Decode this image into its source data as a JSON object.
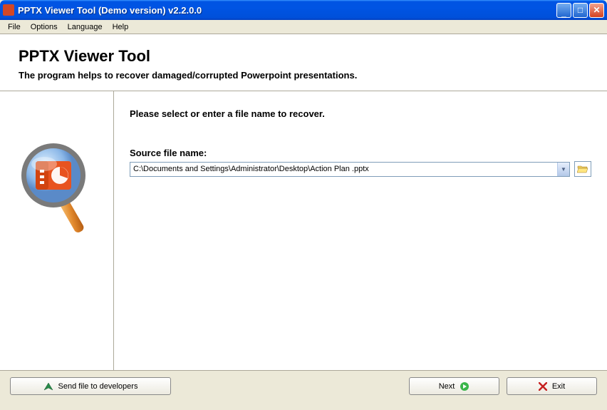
{
  "window": {
    "title": "PPTX Viewer Tool (Demo version) v2.2.0.0"
  },
  "menu": {
    "items": [
      "File",
      "Options",
      "Language",
      "Help"
    ]
  },
  "header": {
    "title": "PPTX Viewer Tool",
    "subtitle": "The program helps to recover damaged/corrupted Powerpoint presentations."
  },
  "main": {
    "instruction": "Please select or enter a file name to recover.",
    "source_label": "Source file name:",
    "source_value": "C:\\Documents and Settings\\Administrator\\Desktop\\Action Plan .pptx"
  },
  "footer": {
    "send_label": "Send file to developers",
    "next_label": "Next",
    "exit_label": "Exit"
  }
}
